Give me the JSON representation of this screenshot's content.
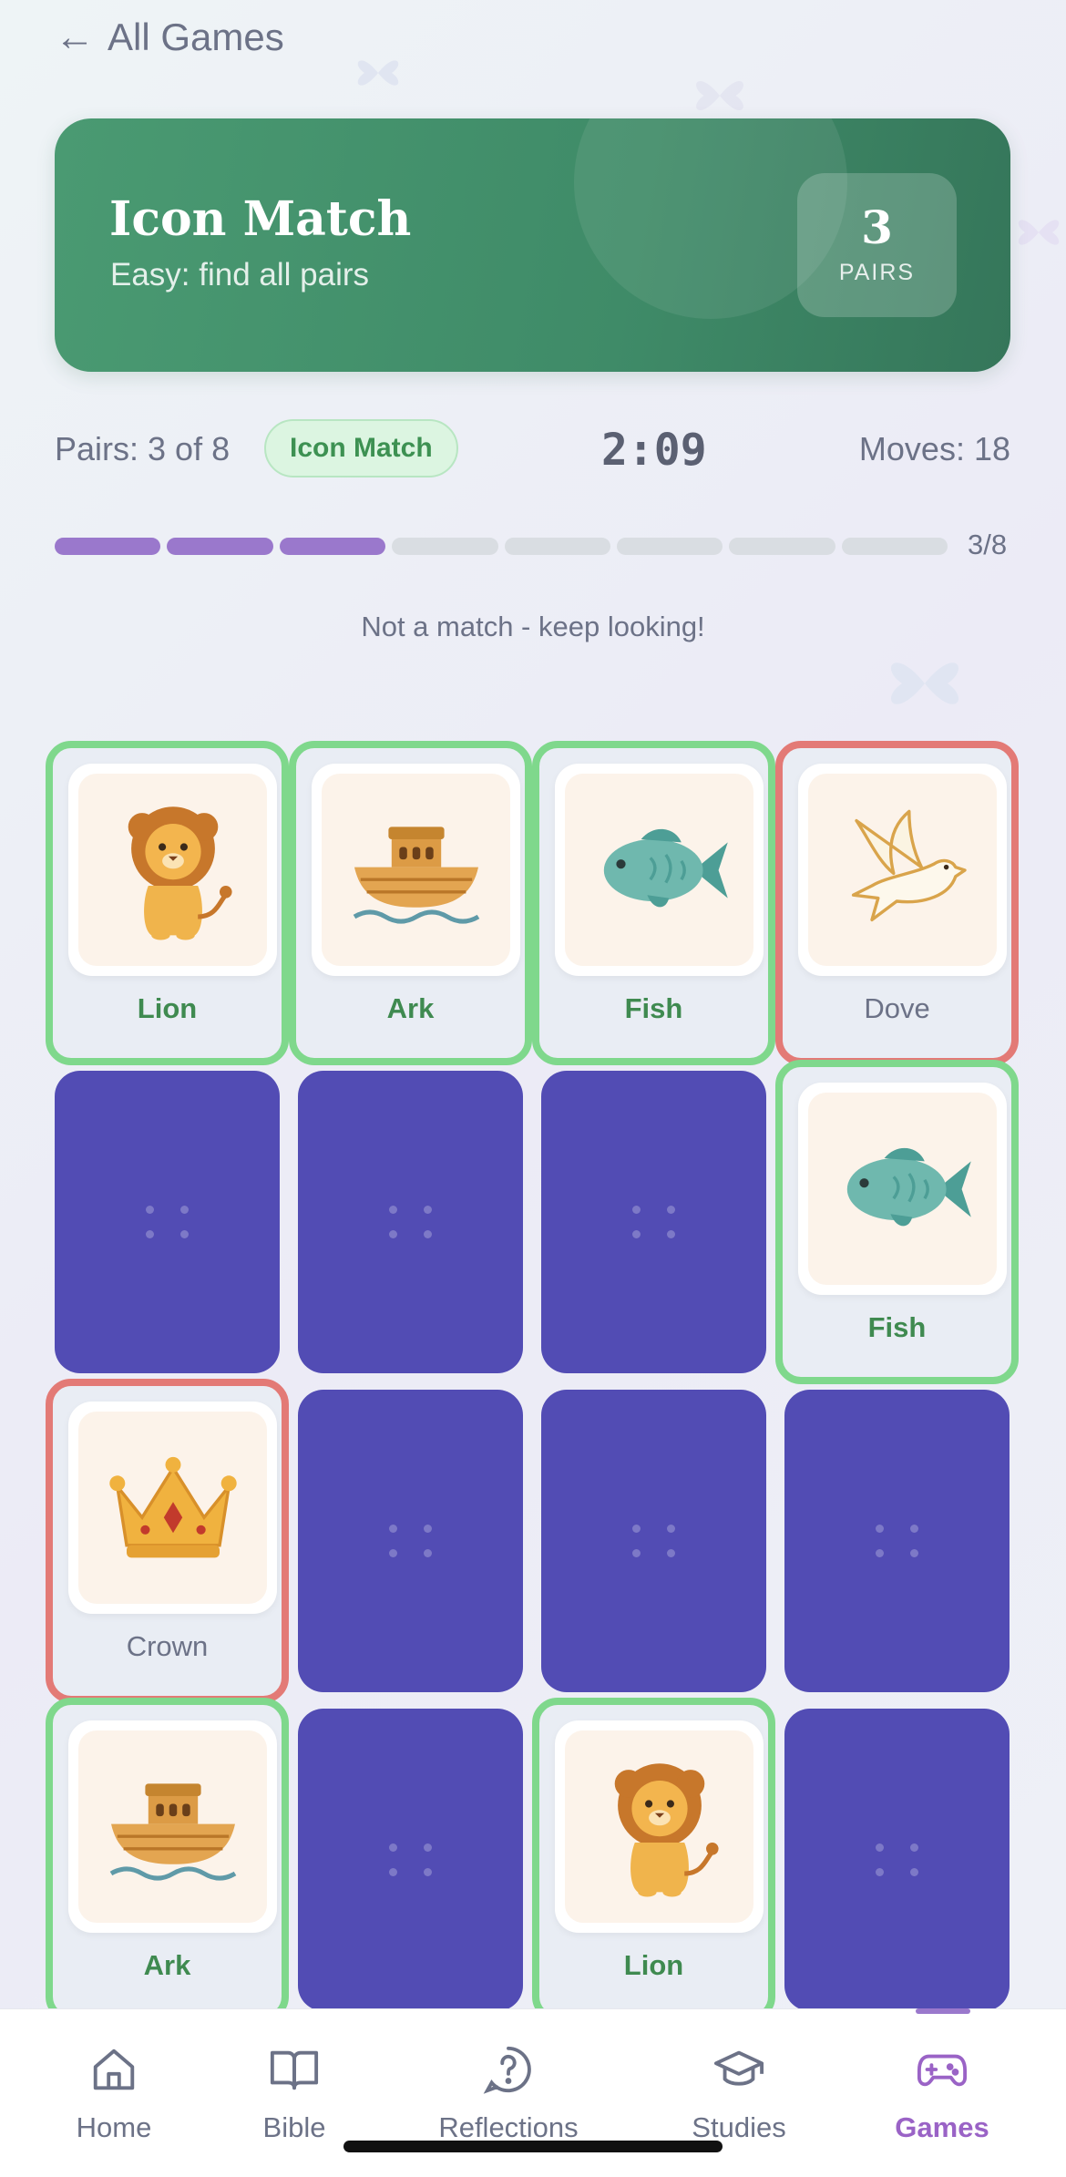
{
  "nav": {
    "back_label": "All Games"
  },
  "hero": {
    "title": "Icon Match",
    "subtitle": "Easy: find all pairs",
    "pairs_number": "3",
    "pairs_label": "PAIRS"
  },
  "status": {
    "pairs_text": "Pairs: 3 of 8",
    "mode_chip": "Icon Match",
    "timer": "2:09",
    "moves_text": "Moves: 18"
  },
  "progress": {
    "filled": 3,
    "total": 8,
    "label": "3/8"
  },
  "message": "Not a match - keep looking!",
  "board": {
    "rows": 4,
    "cols": 4,
    "cards": [
      {
        "state": "matched",
        "icon": "lion-icon",
        "label": "Lion"
      },
      {
        "state": "matched",
        "icon": "ark-icon",
        "label": "Ark"
      },
      {
        "state": "matched",
        "icon": "fish-icon",
        "label": "Fish"
      },
      {
        "state": "wrong",
        "icon": "dove-icon",
        "label": "Dove"
      },
      {
        "state": "hidden"
      },
      {
        "state": "hidden"
      },
      {
        "state": "hidden"
      },
      {
        "state": "matched",
        "icon": "fish-icon",
        "label": "Fish"
      },
      {
        "state": "wrong",
        "icon": "crown-icon",
        "label": "Crown"
      },
      {
        "state": "hidden"
      },
      {
        "state": "hidden"
      },
      {
        "state": "hidden"
      },
      {
        "state": "matched",
        "icon": "ark-icon",
        "label": "Ark"
      },
      {
        "state": "hidden"
      },
      {
        "state": "matched",
        "icon": "lion-icon",
        "label": "Lion"
      },
      {
        "state": "hidden"
      }
    ]
  },
  "tabbar": {
    "items": [
      {
        "label": "Home",
        "icon": "home-icon",
        "active": false
      },
      {
        "label": "Bible",
        "icon": "book-icon",
        "active": false
      },
      {
        "label": "Reflections",
        "icon": "question-bubble-icon",
        "active": false
      },
      {
        "label": "Studies",
        "icon": "graduation-cap-icon",
        "active": false
      },
      {
        "label": "Games",
        "icon": "gamepad-icon",
        "active": true
      }
    ]
  },
  "colors": {
    "hero_green": "#3f8b68",
    "card_back": "#524cb4",
    "matched_border": "#7fd88c",
    "wrong_border": "#e37a76",
    "progress_fill": "#9a78cc",
    "active_tab": "#9a63c6"
  }
}
